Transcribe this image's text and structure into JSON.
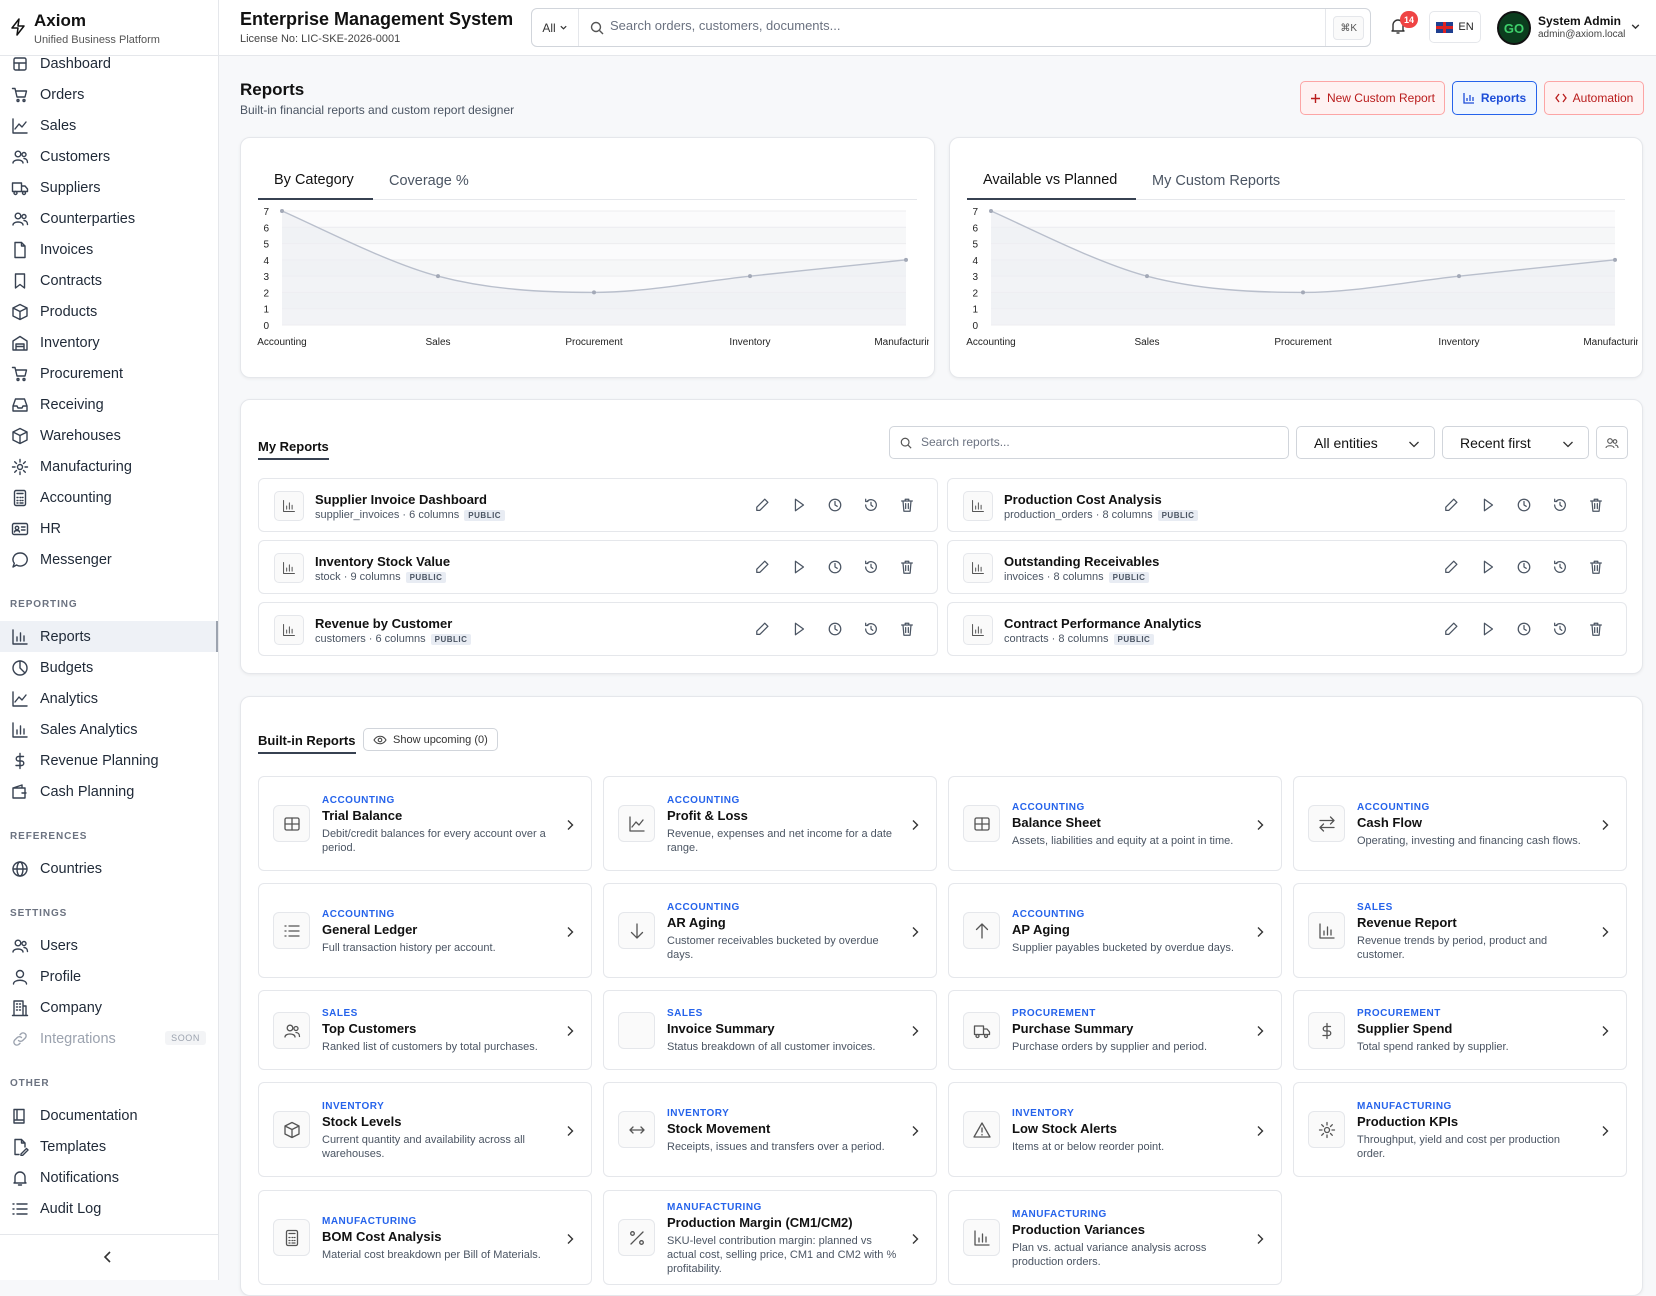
{
  "brand": {
    "name": "Axiom",
    "tagline": "Unified Business Platform"
  },
  "header": {
    "title": "Enterprise Management System",
    "license": "License No: LIC-SKE-2026-0001",
    "search_scope": "All",
    "search_placeholder": "Search orders, customers, documents...",
    "search_shortcut": "⌘K",
    "notifications_count": "14",
    "language": "EN",
    "avatar_text": "GO",
    "user_name": "System Admin",
    "user_email": "admin@axiom.local"
  },
  "sidebar": {
    "items": [
      {
        "label": "Dashboard",
        "icon": "dashboard-icon"
      },
      {
        "label": "Orders",
        "icon": "cart-icon"
      },
      {
        "label": "Sales",
        "icon": "trend-icon"
      },
      {
        "label": "Customers",
        "icon": "users-icon"
      },
      {
        "label": "Suppliers",
        "icon": "truck-icon"
      },
      {
        "label": "Counterparties",
        "icon": "users-icon"
      },
      {
        "label": "Invoices",
        "icon": "file-icon"
      },
      {
        "label": "Contracts",
        "icon": "bookmark-icon"
      },
      {
        "label": "Products",
        "icon": "box-icon"
      },
      {
        "label": "Inventory",
        "icon": "warehouse-icon"
      },
      {
        "label": "Procurement",
        "icon": "cart-icon"
      },
      {
        "label": "Receiving",
        "icon": "inbox-icon"
      },
      {
        "label": "Warehouses",
        "icon": "box-icon"
      },
      {
        "label": "Manufacturing",
        "icon": "gear-icon"
      },
      {
        "label": "Accounting",
        "icon": "calculator-icon"
      },
      {
        "label": "HR",
        "icon": "id-card-icon"
      },
      {
        "label": "Messenger",
        "icon": "chat-icon"
      }
    ],
    "sections": {
      "reporting": {
        "title": "REPORTING",
        "items": [
          {
            "label": "Reports",
            "icon": "bar-chart-icon",
            "active": true
          },
          {
            "label": "Budgets",
            "icon": "pie-icon"
          },
          {
            "label": "Analytics",
            "icon": "trend-icon"
          },
          {
            "label": "Sales Analytics",
            "icon": "bar-chart-icon"
          },
          {
            "label": "Revenue Planning",
            "icon": "dollar-icon"
          },
          {
            "label": "Cash Planning",
            "icon": "wallet-icon"
          }
        ]
      },
      "references": {
        "title": "REFERENCES",
        "items": [
          {
            "label": "Countries",
            "icon": "globe-icon"
          }
        ]
      },
      "settings": {
        "title": "SETTINGS",
        "items": [
          {
            "label": "Users",
            "icon": "users-icon"
          },
          {
            "label": "Profile",
            "icon": "user-icon"
          },
          {
            "label": "Company",
            "icon": "building-icon"
          },
          {
            "label": "Integrations",
            "icon": "link-icon",
            "badge": "SOON",
            "disabled": true
          }
        ]
      },
      "other": {
        "title": "OTHER",
        "items": [
          {
            "label": "Documentation",
            "icon": "book-icon"
          },
          {
            "label": "Templates",
            "icon": "file-edit-icon"
          },
          {
            "label": "Notifications",
            "icon": "bell-icon"
          },
          {
            "label": "Audit Log",
            "icon": "list-icon"
          }
        ]
      }
    }
  },
  "page": {
    "title": "Reports",
    "subtitle": "Built-in financial reports and custom report designer",
    "buttons": {
      "new_custom": "New Custom Report",
      "reports": "Reports",
      "automation": "Automation"
    }
  },
  "chart_panels": [
    {
      "tabs": [
        "By Category",
        "Coverage %"
      ],
      "active_tab": 0
    },
    {
      "tabs": [
        "Available vs Planned",
        "My Custom Reports"
      ],
      "active_tab": 0
    }
  ],
  "chart_data": [
    {
      "type": "area",
      "categories": [
        "Accounting",
        "Sales",
        "Procurement",
        "Inventory",
        "Manufacturing"
      ],
      "values": [
        7,
        3,
        2,
        3,
        4
      ],
      "ylim": [
        0,
        7
      ],
      "yticks": [
        0,
        1,
        2,
        3,
        4,
        5,
        6,
        7
      ],
      "grid": true
    },
    {
      "type": "area",
      "categories": [
        "Accounting",
        "Sales",
        "Procurement",
        "Inventory",
        "Manufacturing"
      ],
      "values": [
        7,
        3,
        2,
        3,
        4
      ],
      "ylim": [
        0,
        7
      ],
      "yticks": [
        0,
        1,
        2,
        3,
        4,
        5,
        6,
        7
      ],
      "grid": true
    }
  ],
  "my_reports": {
    "title": "My Reports",
    "search_placeholder": "Search reports...",
    "entity_filter": "All entities",
    "sort": "Recent first",
    "items": [
      {
        "name": "Supplier Invoice Dashboard",
        "source": "supplier_invoices · 6 columns",
        "badge": "PUBLIC"
      },
      {
        "name": "Production Cost Analysis",
        "source": "production_orders · 8 columns",
        "badge": "PUBLIC"
      },
      {
        "name": "Inventory Stock Value",
        "source": "stock · 9 columns",
        "badge": "PUBLIC"
      },
      {
        "name": "Outstanding Receivables",
        "source": "invoices · 8 columns",
        "badge": "PUBLIC"
      },
      {
        "name": "Revenue by Customer",
        "source": "customers · 6 columns",
        "badge": "PUBLIC"
      },
      {
        "name": "Contract Performance Analytics",
        "source": "contracts · 8 columns",
        "badge": "PUBLIC"
      }
    ]
  },
  "builtin": {
    "title": "Built-in Reports",
    "show_upcoming": "Show upcoming (0)",
    "items": [
      {
        "cat": "ACCOUNTING",
        "name": "Trial Balance",
        "desc": "Debit/credit balances for every account over a period.",
        "icon": "table-icon"
      },
      {
        "cat": "ACCOUNTING",
        "name": "Profit & Loss",
        "desc": "Revenue, expenses and net income for a date range.",
        "icon": "chart-line-icon"
      },
      {
        "cat": "ACCOUNTING",
        "name": "Balance Sheet",
        "desc": "Assets, liabilities and equity at a point in time.",
        "icon": "table-icon"
      },
      {
        "cat": "ACCOUNTING",
        "name": "Cash Flow",
        "desc": "Operating, investing and financing cash flows.",
        "icon": "arrows-icon"
      },
      {
        "cat": "ACCOUNTING",
        "name": "General Ledger",
        "desc": "Full transaction history per account.",
        "icon": "list-icon"
      },
      {
        "cat": "ACCOUNTING",
        "name": "AR Aging",
        "desc": "Customer receivables bucketed by overdue days.",
        "icon": "arrow-down-icon"
      },
      {
        "cat": "ACCOUNTING",
        "name": "AP Aging",
        "desc": "Supplier payables bucketed by overdue days.",
        "icon": "arrow-up-icon"
      },
      {
        "cat": "SALES",
        "name": "Revenue Report",
        "desc": "Revenue trends by period, product and customer.",
        "icon": "bar-chart-icon"
      },
      {
        "cat": "SALES",
        "name": "Top Customers",
        "desc": "Ranked list of customers by total purchases.",
        "icon": "users-icon"
      },
      {
        "cat": "SALES",
        "name": "Invoice Summary",
        "desc": "Status breakdown of all customer invoices.",
        "icon": "blank-icon"
      },
      {
        "cat": "PROCUREMENT",
        "name": "Purchase Summary",
        "desc": "Purchase orders by supplier and period.",
        "icon": "truck-icon"
      },
      {
        "cat": "PROCUREMENT",
        "name": "Supplier Spend",
        "desc": "Total spend ranked by supplier.",
        "icon": "dollar-icon"
      },
      {
        "cat": "INVENTORY",
        "name": "Stock Levels",
        "desc": "Current quantity and availability across all warehouses.",
        "icon": "box-icon"
      },
      {
        "cat": "INVENTORY",
        "name": "Stock Movement",
        "desc": "Receipts, issues and transfers over a period.",
        "icon": "move-icon"
      },
      {
        "cat": "INVENTORY",
        "name": "Low Stock Alerts",
        "desc": "Items at or below reorder point.",
        "icon": "alert-icon"
      },
      {
        "cat": "MANUFACTURING",
        "name": "Production KPIs",
        "desc": "Throughput, yield and cost per production order.",
        "icon": "gear-icon"
      },
      {
        "cat": "MANUFACTURING",
        "name": "BOM Cost Analysis",
        "desc": "Material cost breakdown per Bill of Materials.",
        "icon": "calculator-icon"
      },
      {
        "cat": "MANUFACTURING",
        "name": "Production Margin (CM1/CM2)",
        "desc": "SKU-level contribution margin: planned vs actual cost, selling price, CM1 and CM2 with % profitability.",
        "icon": "percent-icon"
      },
      {
        "cat": "MANUFACTURING",
        "name": "Production Variances",
        "desc": "Plan vs. actual variance analysis across production orders.",
        "icon": "bar-chart-icon"
      }
    ]
  }
}
